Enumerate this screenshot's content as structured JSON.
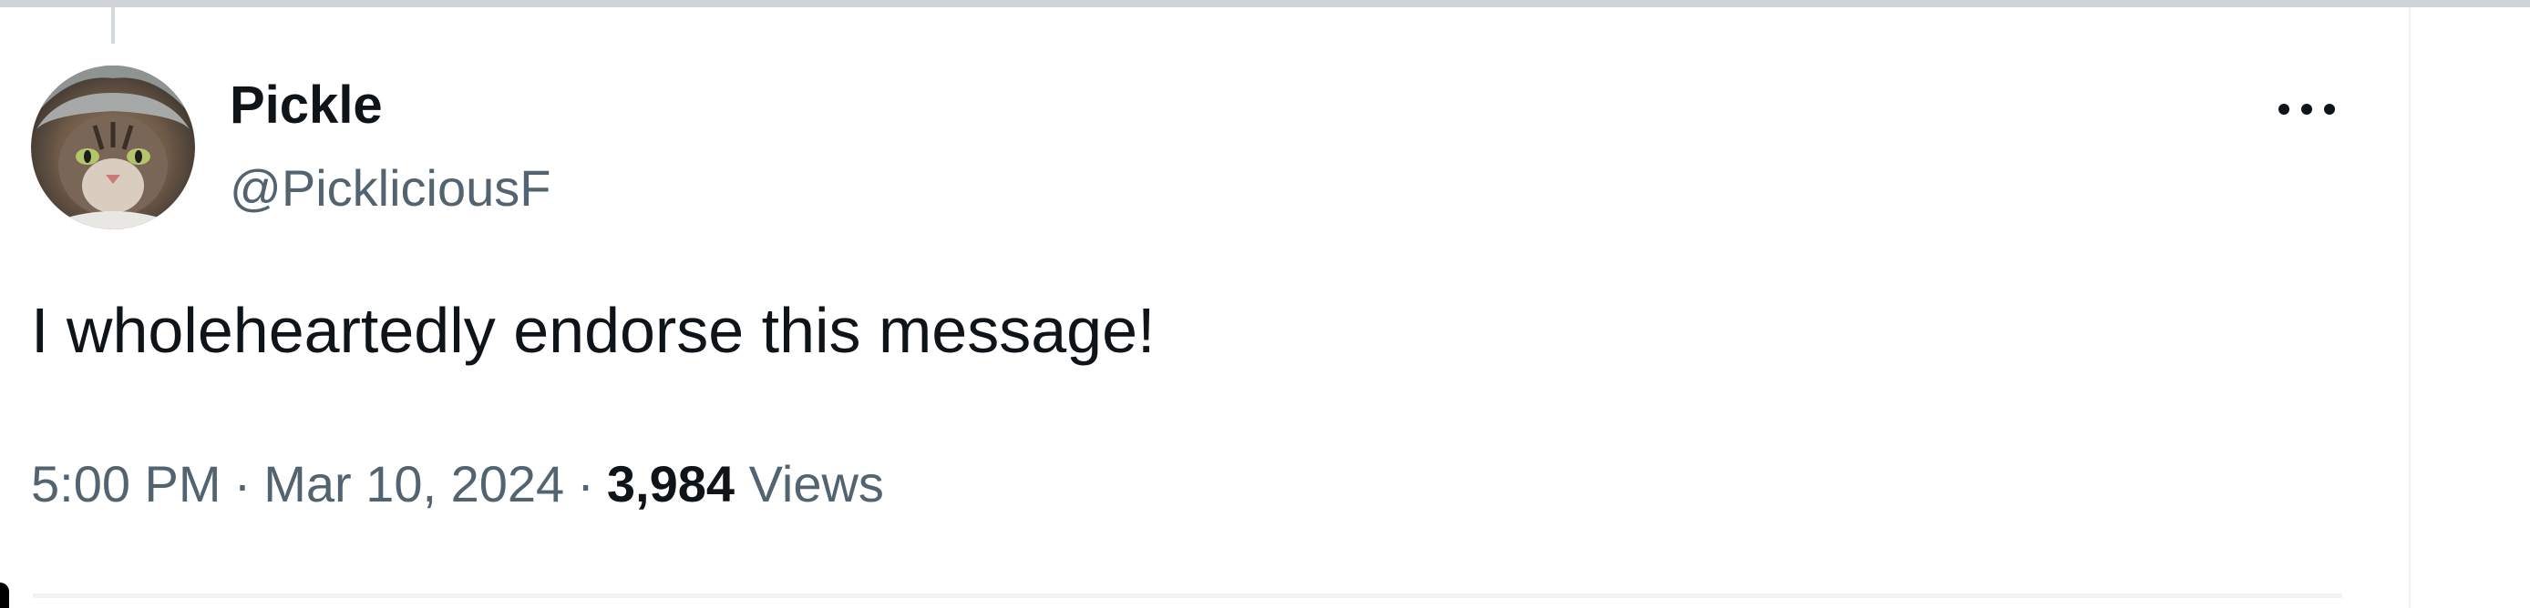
{
  "tweet": {
    "author": {
      "display_name": "Pickle",
      "handle": "@PickliciousF",
      "avatar_icon": "cat-avatar"
    },
    "text": "I wholeheartedly endorse this message!",
    "meta": {
      "time": "5:00 PM",
      "separator": "·",
      "date": "Mar 10, 2024",
      "views_count": "3,984",
      "views_label": "Views"
    },
    "more_icon": "more-horizontal-icon"
  },
  "colors": {
    "text_primary": "#0f1419",
    "text_secondary": "#536471",
    "divider": "#eff3f4"
  }
}
